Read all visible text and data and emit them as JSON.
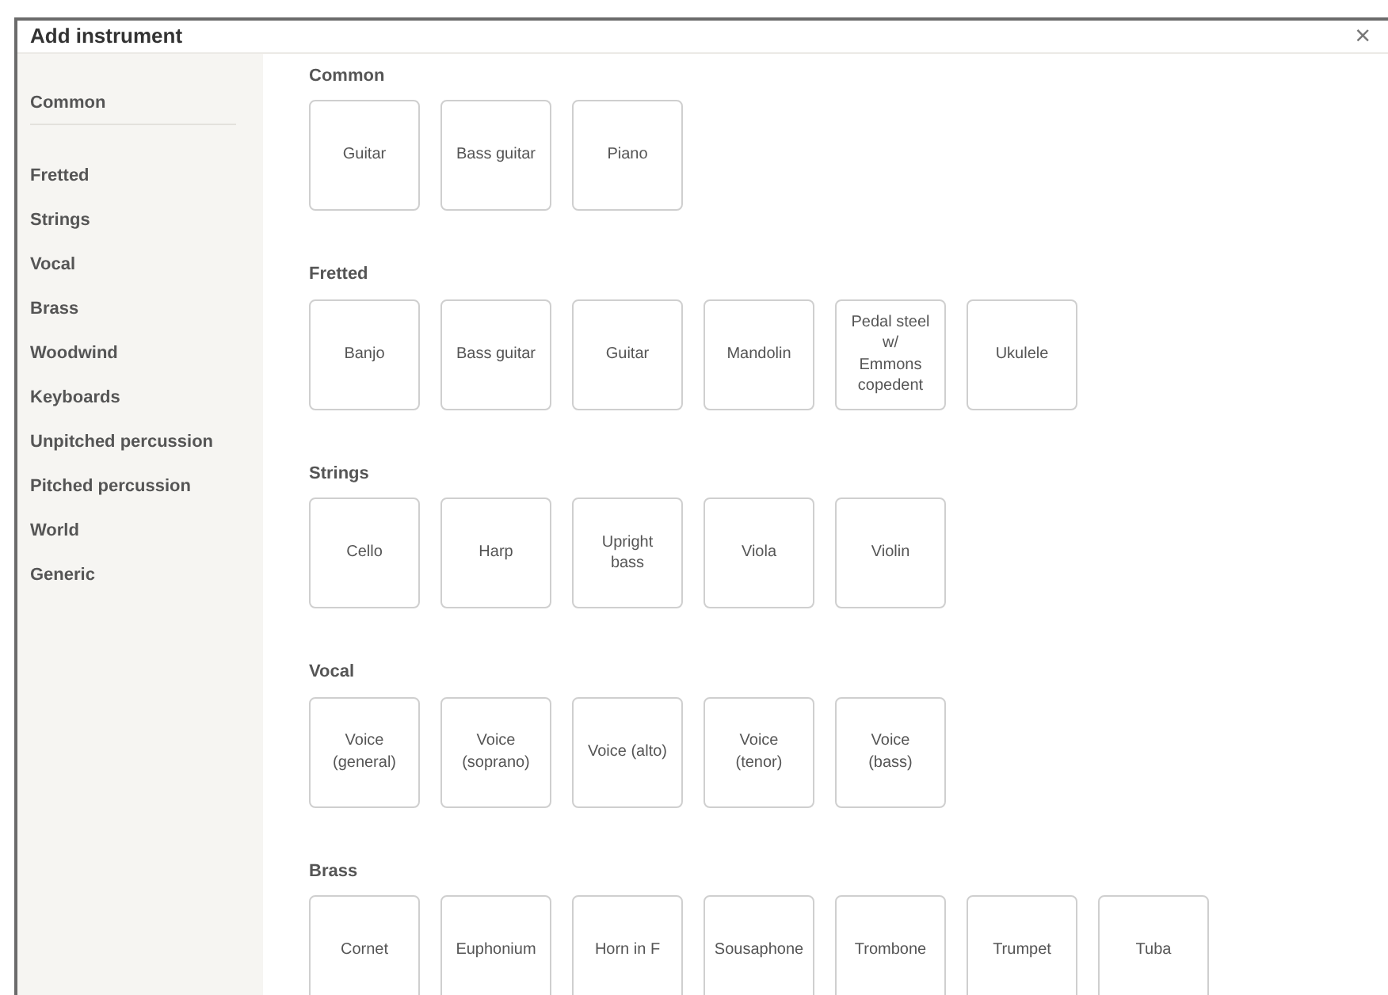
{
  "dialog": {
    "title": "Add instrument",
    "close": "×"
  },
  "sidebar": {
    "items": [
      {
        "label": "Common"
      },
      {
        "label": "Fretted"
      },
      {
        "label": "Strings"
      },
      {
        "label": "Vocal"
      },
      {
        "label": "Brass"
      },
      {
        "label": "Woodwind"
      },
      {
        "label": "Keyboards"
      },
      {
        "label": "Unpitched percussion"
      },
      {
        "label": "Pitched percussion"
      },
      {
        "label": "World"
      },
      {
        "label": "Generic"
      }
    ]
  },
  "sections": [
    {
      "title": "Common",
      "instruments": [
        "Guitar",
        "Bass guitar",
        "Piano"
      ]
    },
    {
      "title": "Fretted",
      "instruments": [
        "Banjo",
        "Bass guitar",
        "Guitar",
        "Mandolin",
        "Pedal steel w/ Emmons copedent",
        "Ukulele"
      ]
    },
    {
      "title": "Strings",
      "instruments": [
        "Cello",
        "Harp",
        "Upright bass",
        "Viola",
        "Violin"
      ]
    },
    {
      "title": "Vocal",
      "instruments": [
        "Voice (general)",
        "Voice (soprano)",
        "Voice (alto)",
        "Voice (tenor)",
        "Voice (bass)"
      ]
    },
    {
      "title": "Brass",
      "instruments": [
        "Cornet",
        "Euphonium",
        "Horn in F",
        "Sousaphone",
        "Trombone",
        "Trumpet",
        "Tuba"
      ]
    }
  ]
}
